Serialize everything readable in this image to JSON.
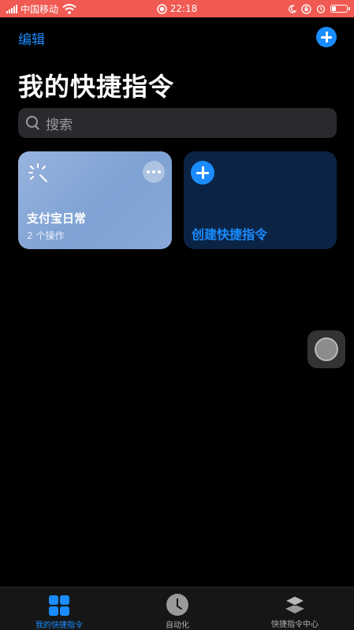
{
  "status_bar": {
    "carrier": "中国移动",
    "time": "22:18"
  },
  "header": {
    "edit_label": "编辑",
    "title": "我的快捷指令"
  },
  "search": {
    "placeholder": "搜索"
  },
  "shortcuts": [
    {
      "title": "支付宝日常",
      "subtitle": "2 个操作",
      "icon": "magic-wand-icon",
      "color": "#8aaad9"
    }
  ],
  "create_card": {
    "label": "创建快捷指令",
    "color": "#0b2446"
  },
  "tabbar": {
    "tabs": [
      {
        "label": "我的快捷指令",
        "icon": "grid-icon",
        "active": true
      },
      {
        "label": "自动化",
        "icon": "clock-icon",
        "active": false
      },
      {
        "label": "快捷指令中心",
        "icon": "layers-icon",
        "active": false
      }
    ]
  },
  "colors": {
    "accent": "#1a8cff",
    "status_bar": "#f05a52",
    "background": "#000000"
  }
}
